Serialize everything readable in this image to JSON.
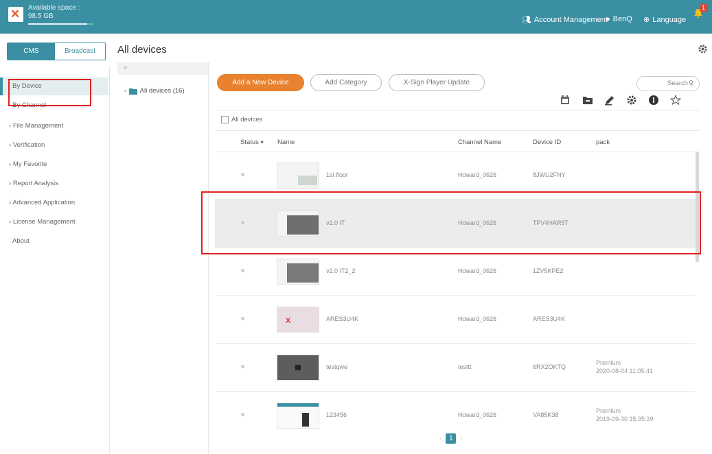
{
  "topbar": {
    "space_label": "Available space :",
    "space_value": "98.5 GB",
    "space_used_fraction": 0.9,
    "account": "Account Management",
    "user": "BenQ",
    "language": "Language",
    "notifications": "1"
  },
  "mode": {
    "cms": "CMS",
    "broadcast": "Broadcast"
  },
  "sidebar": {
    "items": [
      {
        "label": "By Device"
      },
      {
        "label": "By Channel"
      },
      {
        "label": "File Management"
      },
      {
        "label": "Verification"
      },
      {
        "label": "My Favorite"
      },
      {
        "label": "Report Analysis"
      },
      {
        "label": "Advanced Application"
      },
      {
        "label": "License Management"
      },
      {
        "label": "About"
      }
    ]
  },
  "page_title": "All devices",
  "tree": {
    "collapse": "«",
    "root": "All devices (16)"
  },
  "toolbar": {
    "add_device": "Add a New Device",
    "add_category": "Add Category",
    "player_update": "X-Sign Player Update",
    "search_placeholder": "Search..."
  },
  "table": {
    "select_all": "All devices",
    "headers": {
      "status": "Status",
      "name": "Name",
      "channel": "Channel Name",
      "device_id": "Device ID",
      "pack": "pack"
    },
    "rows": [
      {
        "name": "1st floor",
        "channel": "Howard_0626",
        "device_id": "8JWU2FNY",
        "pack": "",
        "pack_date": ""
      },
      {
        "name": "v2.0 IT",
        "channel": "Howard_0626",
        "device_id": "TPV4HAR5T",
        "pack": "",
        "pack_date": ""
      },
      {
        "name": "v2.0 IT2_2",
        "channel": "Howard_0626",
        "device_id": "1ZV5KPE2",
        "pack": "",
        "pack_date": ""
      },
      {
        "name": "ARES3U4K",
        "channel": "Howard_0626",
        "device_id": "ARES3U4K",
        "pack": "",
        "pack_date": ""
      },
      {
        "name": "testqwe",
        "channel": "testtt",
        "device_id": "6RX2OKTQ",
        "pack": "Premium",
        "pack_date": "2020-08-04 11:05:41"
      },
      {
        "name": "123456",
        "channel": "Howard_0626",
        "device_id": "VA85K38",
        "pack": "Premium",
        "pack_date": "2019-09-30 15:35:39"
      }
    ]
  },
  "pager": {
    "prev": "‹",
    "page": "1",
    "next": "›"
  },
  "colors": {
    "accent": "#3a8fa3",
    "primary_button": "#e8822f",
    "highlight": "#e02020"
  }
}
